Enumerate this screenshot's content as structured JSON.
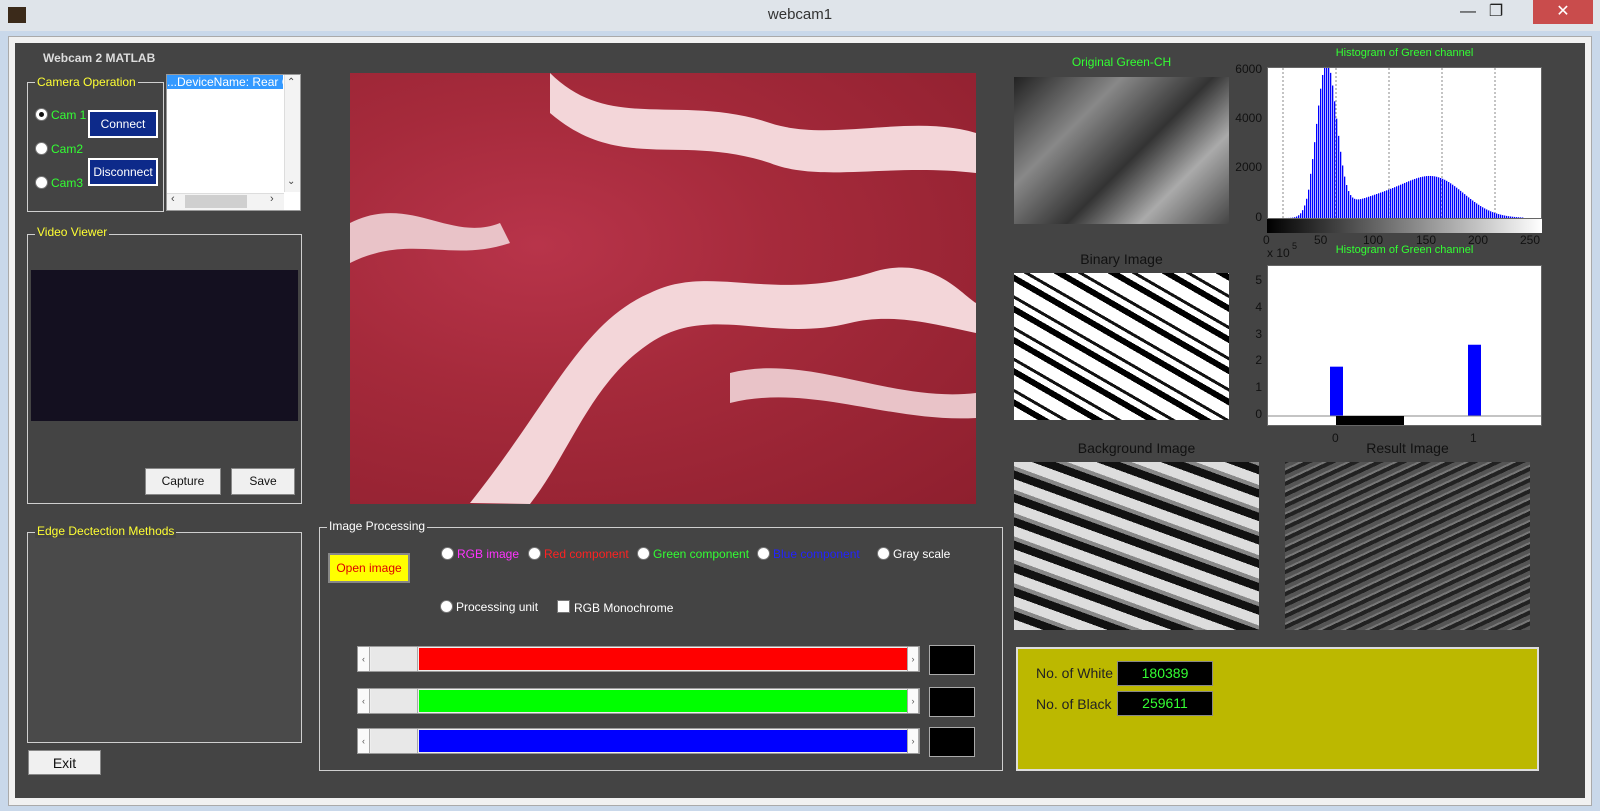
{
  "window": {
    "title": "webcam1",
    "minimize": "—",
    "maximize": "❐",
    "close": "✕"
  },
  "app": {
    "heading": "Webcam 2 MATLAB"
  },
  "camera": {
    "title": "Camera Operation",
    "cam1": "Cam 1",
    "cam2": "Cam2",
    "cam3": "Cam3",
    "connect": "Connect",
    "disconnect": "Disconnect",
    "device_item": "...DeviceName: Rear C",
    "selected": "Cam 1"
  },
  "video": {
    "title": "Video Viewer",
    "capture": "Capture",
    "save": "Save"
  },
  "edge": {
    "title": "Edge Dectection Methods"
  },
  "exit": "Exit",
  "processing": {
    "title": "Image Processing",
    "open": "Open image",
    "rgb": "RGB image",
    "red": "Red component",
    "green": "Green component",
    "blue": "Blue component",
    "gray": "Gray scale",
    "unit": "Processing unit",
    "mono": "RGB Monochrome"
  },
  "sliders": {
    "colors": [
      "#ff0000",
      "#00ff00",
      "#0000ff"
    ],
    "values": [
      0,
      0,
      0
    ]
  },
  "images": {
    "original": "Original Green-CH",
    "binary": "Binary Image",
    "background": "Background Image",
    "result": "Result Image"
  },
  "hist1": {
    "title": "Histogram of Green channel",
    "yticks": [
      "6000",
      "4000",
      "2000",
      "0"
    ],
    "xticks": [
      "0",
      "50",
      "100",
      "150",
      "200",
      "250"
    ],
    "exp": "x 10",
    "exp_power": "5"
  },
  "hist2": {
    "title": "Histogram of Green channel",
    "yticks": [
      "5",
      "4",
      "3",
      "2",
      "1",
      "0"
    ],
    "xticks": [
      "0",
      "1"
    ]
  },
  "counts": {
    "white_label": "No. of White",
    "white": "180389",
    "black_label": "No. of Black",
    "black": "259611"
  },
  "colors": {
    "accent_yellow": "#ffff33",
    "label_green": "#33ff33",
    "result_panel": "#bcb800"
  }
}
